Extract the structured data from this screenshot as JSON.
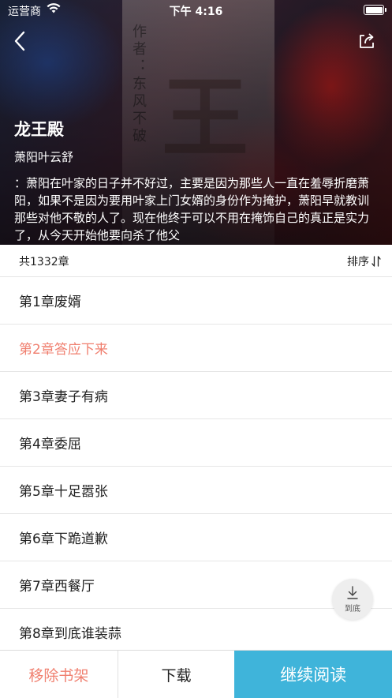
{
  "status_bar": {
    "carrier": "运营商",
    "time": "下午 4:16"
  },
  "header": {
    "cover_calligraphy": "作者：东风不破",
    "cover_char": "王",
    "back_icon": "chevron-left-icon",
    "share_icon": "share-icon"
  },
  "book": {
    "title": "龙王殿",
    "author": "萧阳叶云舒",
    "description": "：萧阳在叶家的日子并不好过，主要是因为那些人一直在羞辱折磨萧阳，如果不是因为要用叶家上门女婿的身份作为掩护，萧阳早就教训那些对他不敬的人了。现在他终于可以不用在掩饰自己的真正是实力了，从今天开始他要向杀了他父"
  },
  "chapter_bar": {
    "count": "共1332章",
    "sort_label": "排序",
    "sort_icon": "sort-icon"
  },
  "chapters": [
    {
      "label": "第1章废婿",
      "current": false
    },
    {
      "label": "第2章答应下来",
      "current": true
    },
    {
      "label": "第3章妻子有病",
      "current": false
    },
    {
      "label": "第4章委屈",
      "current": false
    },
    {
      "label": "第5章十足嚣张",
      "current": false
    },
    {
      "label": "第6章下跪道歉",
      "current": false
    },
    {
      "label": "第7章西餐厅",
      "current": false
    },
    {
      "label": "第8章到底谁装蒜",
      "current": false
    }
  ],
  "scroll_bottom": {
    "label": "到底",
    "icon": "download-arrow-icon"
  },
  "footer": {
    "remove_label": "移除书架",
    "download_label": "下载",
    "read_label": "继续阅读"
  },
  "colors": {
    "accent_blue": "#3fb4da",
    "current_chapter": "#f08070",
    "remove_text": "#f08070"
  }
}
